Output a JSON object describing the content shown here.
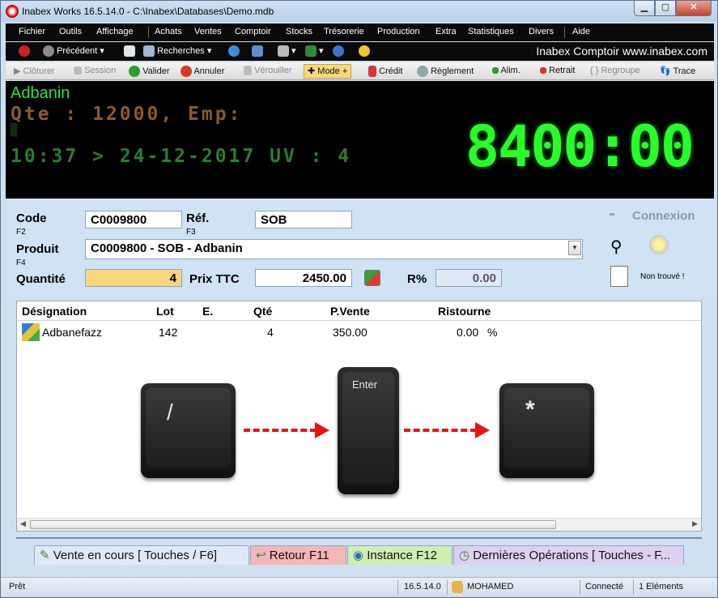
{
  "window": {
    "title": "Inabex Works 16.5.14.0 - C:\\Inabex\\Databases\\Demo.mdb"
  },
  "menu": [
    "Fichier",
    "Outils",
    "Affichage",
    "Achats",
    "Ventes",
    "Comptoir",
    "Stocks",
    "Trésorerie",
    "Production",
    "Extra",
    "Statistiques",
    "Divers",
    "Aide"
  ],
  "toolbar1": {
    "back_label": "Précédent",
    "search_label": "Recherches",
    "brand": "Inabex Comptoir  www.inabex.com"
  },
  "toolbar2": {
    "cloturer": "Clôturer",
    "session": "Session",
    "valider": "Valider",
    "annuler": "Annuler",
    "verrouiller": "Vérouiller",
    "mode": "Mode +",
    "credit": "Crédit",
    "reglement": "Règlement",
    "alim": "Alim.",
    "retrait": "Retrait",
    "regroupe": "Regroupe",
    "trace": "Trace"
  },
  "display": {
    "product": "Adbanin",
    "line1": "Qte : 12000, Emp:",
    "line2": "▒",
    "line3": "10:37 > 24-12-2017 UV : 4",
    "amount": "8400:00"
  },
  "form": {
    "code_label": "Code",
    "code_key": "F2",
    "code_value": "C0009800",
    "ref_label": "Réf.",
    "ref_key": "F3",
    "ref_value": "SOB",
    "produit_label": "Produit",
    "produit_key": "F4",
    "produit_value": "C0009800 - SOB - Adbanin",
    "quantite_label": "Quantité",
    "quantite_value": "4",
    "prix_label": "Prix TTC",
    "prix_value": "2450.00",
    "remise_label": "R%",
    "remise_value": "0.00",
    "connexion": "Connexion",
    "non_trouve": "Non trouvé !"
  },
  "grid": {
    "columns": [
      "Désignation",
      "Lot",
      "E.",
      "Qté",
      "P.Vente",
      "Ristourne"
    ],
    "rows": [
      {
        "designation": "Adbanefazz",
        "lot": "142",
        "e": "",
        "qte": "4",
        "pvente": "350.00",
        "ristourne": "0.00",
        "unit": "%"
      }
    ]
  },
  "keys": {
    "k1": "/",
    "k2": "Enter",
    "k3": "*"
  },
  "tabs": {
    "vente": "Vente en cours [ Touches / F6]",
    "retour": "Retour F11",
    "instance": "Instance F12",
    "dernieres": "Dernières Opérations [ Touches - F..."
  },
  "status": {
    "ready": "Prêt",
    "version": "16.5.14.0",
    "user": "MOHAMED",
    "connected": "Connecté",
    "elements": "1 Eléments"
  }
}
